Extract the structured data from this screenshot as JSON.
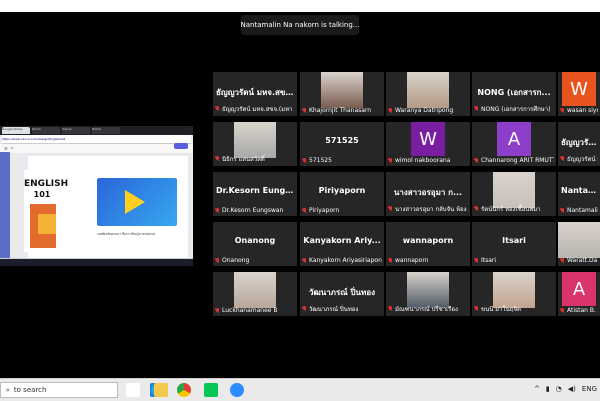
{
  "window": {
    "speaking_indicator": "Nantamalin Na nakorn is talking..."
  },
  "shared_screen": {
    "browser_tabs": [
      "Google Slides",
      "Zoom",
      "Canva",
      "Home"
    ],
    "address": "https://www.canva.com/design/English101",
    "cover_title": "ENGLISH",
    "cover_number": "101",
    "caption": "แอพลิเคชันแคนวา สื่อการเรียนรู้ภาษาอังกฤษ"
  },
  "participants": [
    {
      "big": "ธัญญวรัตน์ มหจ.สข...",
      "label": "ธัญญวรัตน์ มหจ.สขจ.(มหา",
      "type": "text"
    },
    {
      "big": "",
      "label": "Khajornjit Thanasarn",
      "type": "photo",
      "color": "#7a5c4f"
    },
    {
      "big": "",
      "label": "Waranya Datripong",
      "type": "photo",
      "color": "#b39a84"
    },
    {
      "big": "NONG (เอกสารก...",
      "label": "NONG (เอกสารการศึกษา)",
      "type": "text"
    },
    {
      "big": "",
      "label": "wasan siyo",
      "type": "letter",
      "letter": "W",
      "color": "#e8541d"
    },
    {
      "big": "",
      "label": "นิธิกร แสนสวัสดิ์",
      "type": "photo",
      "color": "#a8a8a8"
    },
    {
      "big": "571525",
      "label": "571525",
      "type": "text"
    },
    {
      "big": "",
      "label": "wimol nakboorana",
      "type": "letter",
      "letter": "W",
      "color": "#7a1ea1"
    },
    {
      "big": "",
      "label": "Channarong ARIT RMUTT",
      "type": "letter",
      "letter": "A",
      "color": "#8e3fc9"
    },
    {
      "big": "ธัญญวรัตน์",
      "label": "ธัญญวรัตน์ มหจ.",
      "type": "text"
    },
    {
      "big": "Dr.Kesorn Eungs...",
      "label": "Dr.Kesorn Eungswan",
      "type": "text"
    },
    {
      "big": "Piriyaporn",
      "label": "Piriyaporn",
      "type": "text"
    },
    {
      "big": "นางสาวอรอุมา ก...",
      "label": "นางสาวอรอุมา กลับจัน ห้อง",
      "type": "text"
    },
    {
      "big": "",
      "label": "รัตน์นิกร์ ทองเชื้อนพมา",
      "type": "photo",
      "color": "#c7c0b8"
    },
    {
      "big": "Nantama",
      "label": "Nantamalin Na nakorn",
      "type": "text"
    },
    {
      "big": "Onanong",
      "label": "Onanong",
      "type": "text"
    },
    {
      "big": "Kanyakorn Ariy...",
      "label": "Kanyakorn Ariyasiriapon",
      "type": "text"
    },
    {
      "big": "wannaporn",
      "label": "wannaporn",
      "type": "text"
    },
    {
      "big": "Itsari",
      "label": "Itsari",
      "type": "text"
    },
    {
      "big": "",
      "label": "Waratt.Da",
      "type": "photo",
      "color": "#b9b4ae"
    },
    {
      "big": "",
      "label": "Luckhanamanee B",
      "type": "photo",
      "color": "#b7a79b"
    },
    {
      "big": "วัฒนาภรณ์ ปิ่นทอง",
      "label": "วัฒนาภรณ์ ปิ่นทอง",
      "type": "text"
    },
    {
      "big": "",
      "label": "มัณฑนาภรณ์ ปรีชาเรือง",
      "type": "photo",
      "color": "#505a66"
    },
    {
      "big": "",
      "label": "ขนนี มาโนฤจิต",
      "type": "photo",
      "color": "#c2a48e"
    },
    {
      "big": "",
      "label": "Atistan B.",
      "type": "letter",
      "letter": "A",
      "color": "#d9346b"
    }
  ],
  "taskbar": {
    "search_placeholder": "to search",
    "language": "ENG"
  }
}
